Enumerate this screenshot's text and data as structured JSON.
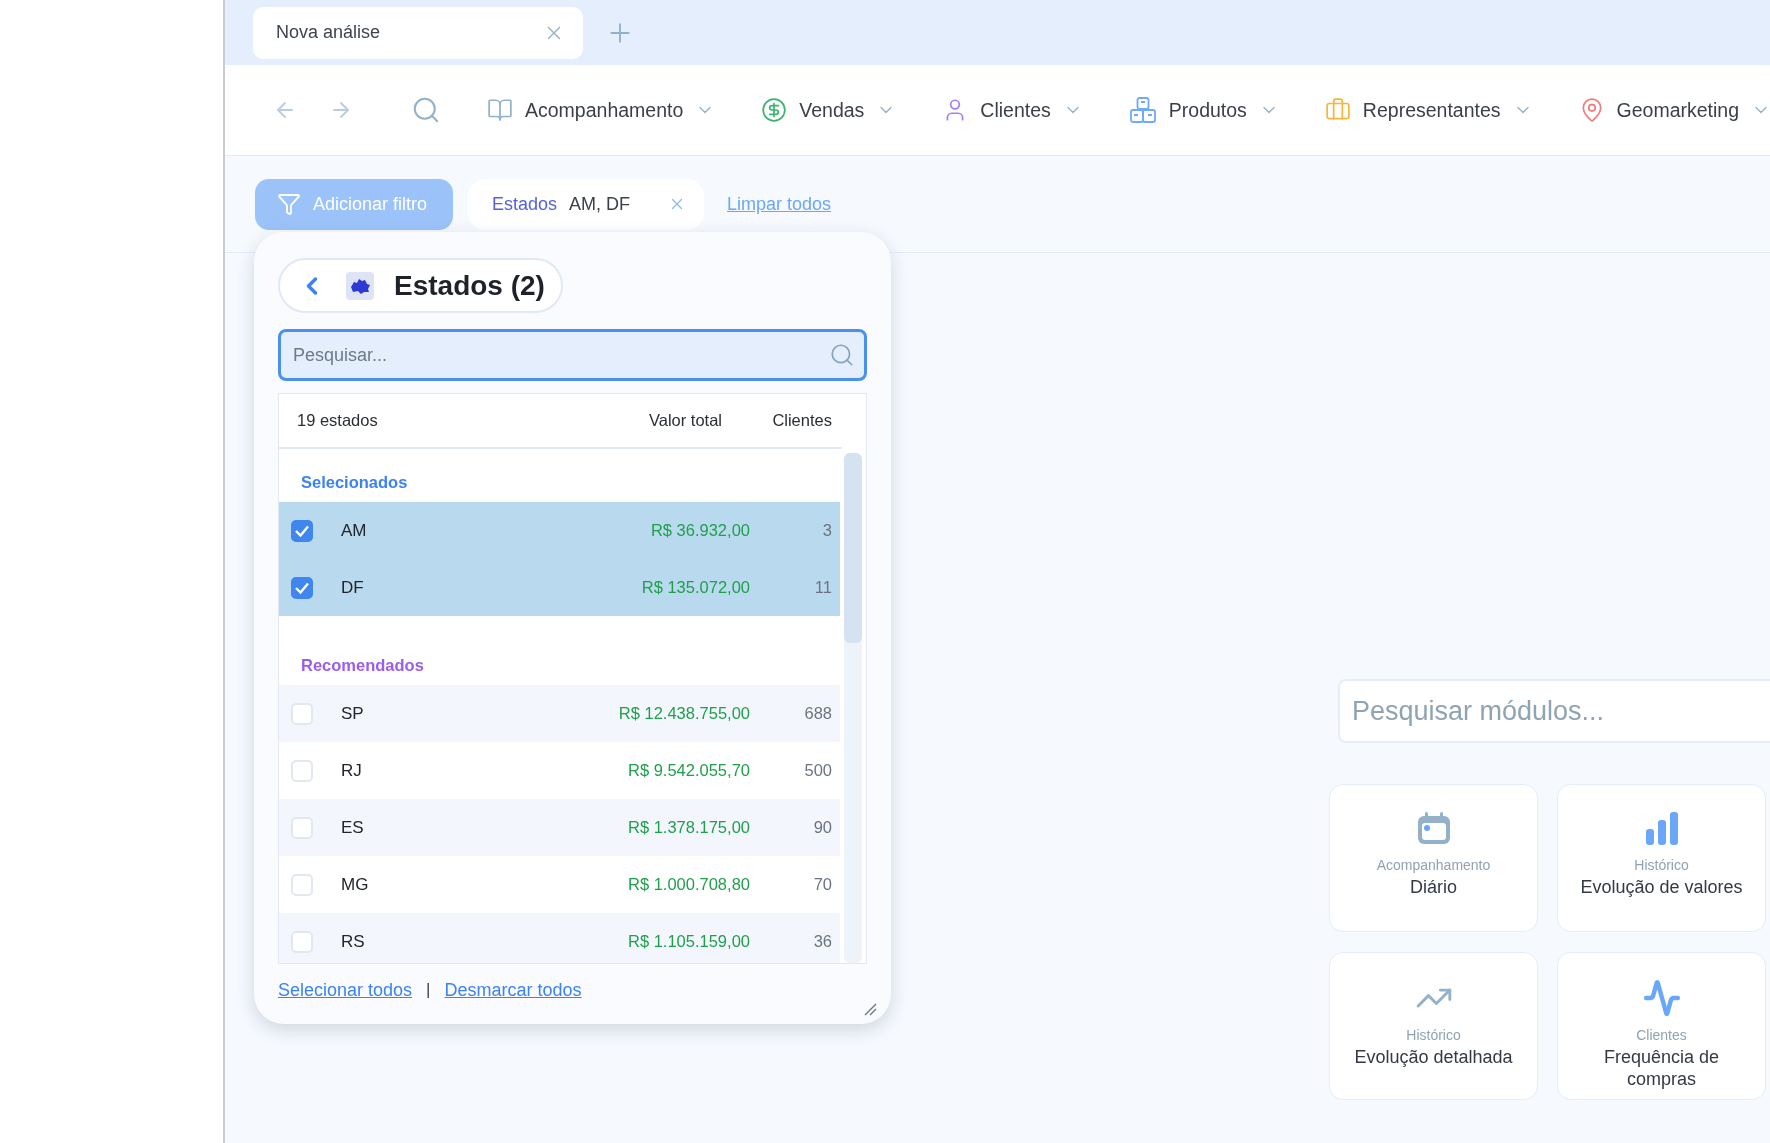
{
  "tabs": [
    {
      "label": "Nova análise",
      "selected": true
    }
  ],
  "nav": {
    "items": [
      {
        "kind": "book",
        "label": "Acompanhamento"
      },
      {
        "kind": "dollar",
        "label": "Vendas"
      },
      {
        "kind": "person",
        "label": "Clientes"
      },
      {
        "kind": "boxes",
        "label": "Produtos"
      },
      {
        "kind": "briefcase",
        "label": "Representantes"
      },
      {
        "kind": "pin",
        "label": "Geomarketing"
      }
    ]
  },
  "filters": {
    "add_button": "Adicionar filtro",
    "chips": [
      {
        "field": "Estados",
        "value": "AM, DF"
      }
    ],
    "clear_link": "Limpar todos"
  },
  "popup": {
    "title": "Estados (2)",
    "search": {
      "placeholder": "Pesquisar..."
    },
    "columns": [
      "19 estados",
      "Valor total",
      "Clientes"
    ],
    "groups": [
      {
        "kind": "selected",
        "title": "Selecionados",
        "rows": [
          {
            "state": "AM",
            "value": "R$ 36.932,00",
            "clients": "3",
            "checked": true
          },
          {
            "state": "DF",
            "value": "R$ 135.072,00",
            "clients": "11",
            "checked": true
          }
        ]
      },
      {
        "kind": "recommended",
        "title": "Recomendados",
        "rows": [
          {
            "state": "SP",
            "value": "R$ 12.438.755,00",
            "clients": "688",
            "checked": false
          },
          {
            "state": "RJ",
            "value": "R$ 9.542.055,70",
            "clients": "500",
            "checked": false
          },
          {
            "state": "ES",
            "value": "R$ 1.378.175,00",
            "clients": "90",
            "checked": false
          },
          {
            "state": "MG",
            "value": "R$ 1.000.708,80",
            "clients": "70",
            "checked": false
          },
          {
            "state": "RS",
            "value": "R$ 1.105.159,00",
            "clients": "36",
            "checked": false
          }
        ]
      }
    ],
    "footer": {
      "links": [
        "Selecionar todos",
        "Desmarcar todos"
      ],
      "separator": "|"
    }
  },
  "modules": {
    "search": {
      "placeholder": "Pesquisar módulos..."
    },
    "cards": [
      {
        "kind": "calendar",
        "category": "Acompanhamento",
        "title": "Diário"
      },
      {
        "kind": "bars",
        "category": "Histórico",
        "title": "Evolução de valores"
      },
      {
        "kind": "trend",
        "category": "Histórico",
        "title": "Evolução detalhada"
      },
      {
        "kind": "pulse",
        "category": "Clientes",
        "title": "Frequência de compras"
      }
    ]
  }
}
